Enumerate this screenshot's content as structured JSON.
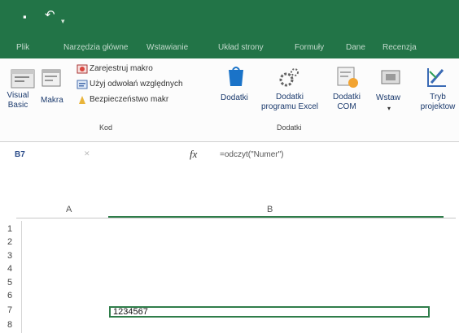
{
  "tabs": [
    "Plik",
    "Narzędzia główne",
    "Wstawianie",
    "Układ strony",
    "Formuły",
    "Dane",
    "Recenzja"
  ],
  "ribbon": {
    "visual_basic": [
      "Visual",
      "Basic"
    ],
    "makra": "Makra",
    "record_macro": "Zarejestruj makro",
    "relative_refs": "Użyj odwołań względnych",
    "macro_security": "Bezpieczeństwo makr",
    "group_kod": "Kod",
    "dodatki": "Dodatki",
    "excel_addins": [
      "Dodatki",
      "programu Excel"
    ],
    "com_addins": [
      "Dodatki",
      "COM"
    ],
    "group_dodatki": "Dodatki",
    "wstaw": "Wstaw",
    "tryb": [
      "Tryb",
      "projektow"
    ]
  },
  "formula_bar": {
    "name_box": "B7",
    "fx": "fx",
    "formula": "=odczyt(\"Numer\")"
  },
  "columns": [
    "A",
    "B"
  ],
  "rows": [
    "1",
    "2",
    "3",
    "4",
    "5",
    "6",
    "7",
    "8"
  ],
  "cell_b7": "1234567"
}
